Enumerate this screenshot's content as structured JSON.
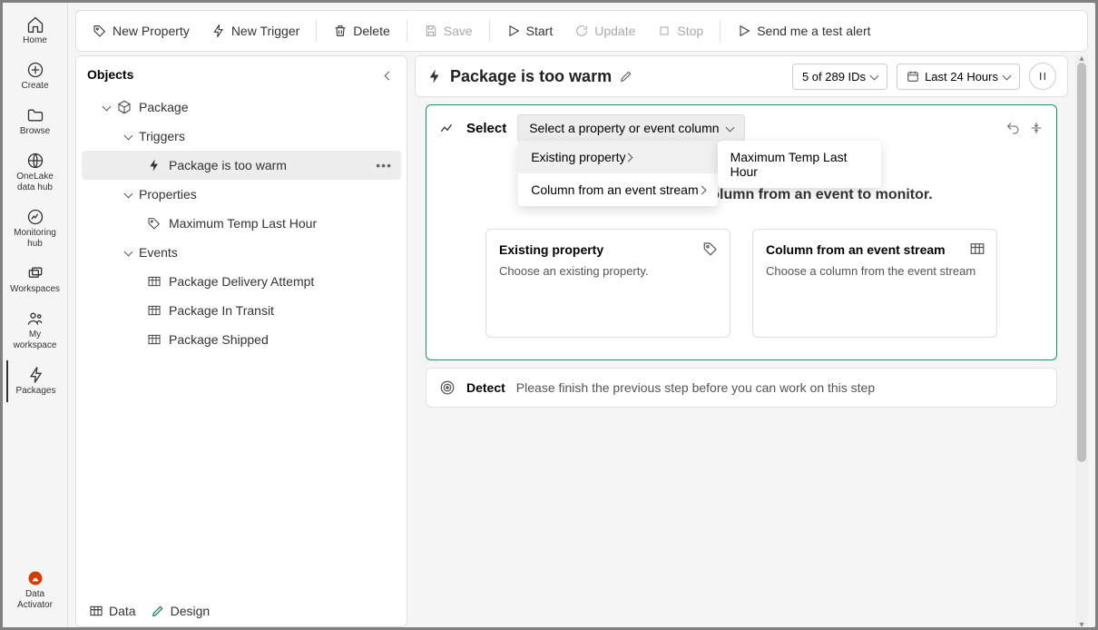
{
  "rail": {
    "items": [
      {
        "label": "Home"
      },
      {
        "label": "Create"
      },
      {
        "label": "Browse"
      },
      {
        "label": "OneLake data hub"
      },
      {
        "label": "Monitoring hub"
      },
      {
        "label": "Workspaces"
      },
      {
        "label": "My workspace"
      },
      {
        "label": "Packages"
      }
    ],
    "footer_label": "Data Activator"
  },
  "toolbar": {
    "new_property": "New Property",
    "new_trigger": "New Trigger",
    "delete": "Delete",
    "save": "Save",
    "start": "Start",
    "update": "Update",
    "stop": "Stop",
    "send_test": "Send me a test alert"
  },
  "objects": {
    "title": "Objects",
    "package": "Package",
    "triggers": "Triggers",
    "trigger1": "Package is too warm",
    "properties": "Properties",
    "property1": "Maximum Temp Last Hour",
    "events": "Events",
    "event1": "Package Delivery Attempt",
    "event2": "Package In Transit",
    "event3": "Package Shipped"
  },
  "header": {
    "title": "Package is too warm",
    "ids_pill": "5 of 289 IDs",
    "time_pill": "Last 24 Hours"
  },
  "step": {
    "label": "Select",
    "dropdown_label": "Select a property or event column",
    "menu_existing": "Existing property",
    "menu_column": "Column from an event stream",
    "submenu_item": "Maximum Temp Last Hour",
    "body_msg": "Select a property or a column from an event to monitor.",
    "card1_title": "Existing property",
    "card1_desc": "Choose an existing property.",
    "card2_title": "Column from an event stream",
    "card2_desc": "Choose a column from the event stream"
  },
  "detect": {
    "label": "Detect",
    "msg": "Please finish the previous step before you can work on this step"
  },
  "bottom": {
    "data": "Data",
    "design": "Design"
  }
}
